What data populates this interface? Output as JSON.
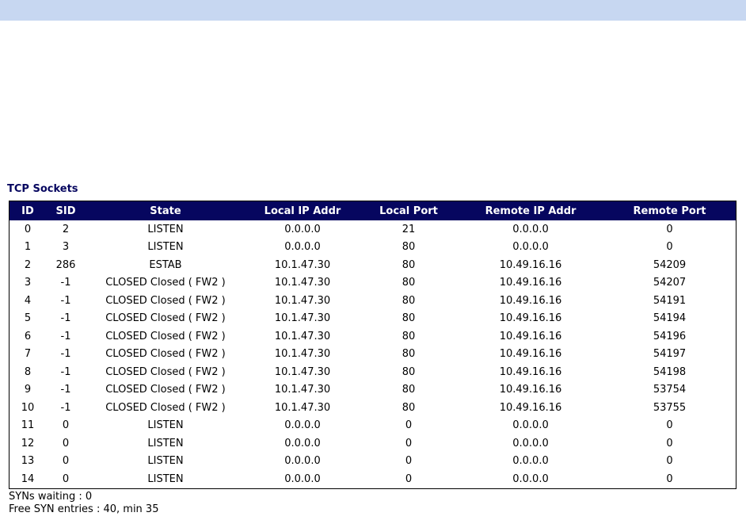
{
  "section_title": "TCP Sockets",
  "columns": [
    "ID",
    "SID",
    "State",
    "Local IP Addr",
    "Local Port",
    "Remote IP Addr",
    "Remote Port"
  ],
  "rows": [
    [
      "0",
      "2",
      "LISTEN",
      "0.0.0.0",
      "21",
      "0.0.0.0",
      "0"
    ],
    [
      "1",
      "3",
      "LISTEN",
      "0.0.0.0",
      "80",
      "0.0.0.0",
      "0"
    ],
    [
      "2",
      "286",
      "ESTAB",
      "10.1.47.30",
      "80",
      "10.49.16.16",
      "54209"
    ],
    [
      "3",
      "-1",
      "CLOSED Closed ( FW2 )",
      "10.1.47.30",
      "80",
      "10.49.16.16",
      "54207"
    ],
    [
      "4",
      "-1",
      "CLOSED Closed ( FW2 )",
      "10.1.47.30",
      "80",
      "10.49.16.16",
      "54191"
    ],
    [
      "5",
      "-1",
      "CLOSED Closed ( FW2 )",
      "10.1.47.30",
      "80",
      "10.49.16.16",
      "54194"
    ],
    [
      "6",
      "-1",
      "CLOSED Closed ( FW2 )",
      "10.1.47.30",
      "80",
      "10.49.16.16",
      "54196"
    ],
    [
      "7",
      "-1",
      "CLOSED Closed ( FW2 )",
      "10.1.47.30",
      "80",
      "10.49.16.16",
      "54197"
    ],
    [
      "8",
      "-1",
      "CLOSED Closed ( FW2 )",
      "10.1.47.30",
      "80",
      "10.49.16.16",
      "54198"
    ],
    [
      "9",
      "-1",
      "CLOSED Closed ( FW2 )",
      "10.1.47.30",
      "80",
      "10.49.16.16",
      "53754"
    ],
    [
      "10",
      "-1",
      "CLOSED Closed ( FW2 )",
      "10.1.47.30",
      "80",
      "10.49.16.16",
      "53755"
    ],
    [
      "11",
      "0",
      "LISTEN",
      "0.0.0.0",
      "0",
      "0.0.0.0",
      "0"
    ],
    [
      "12",
      "0",
      "LISTEN",
      "0.0.0.0",
      "0",
      "0.0.0.0",
      "0"
    ],
    [
      "13",
      "0",
      "LISTEN",
      "0.0.0.0",
      "0",
      "0.0.0.0",
      "0"
    ],
    [
      "14",
      "0",
      "LISTEN",
      "0.0.0.0",
      "0",
      "0.0.0.0",
      "0"
    ]
  ],
  "footer": {
    "syns_waiting": "SYNs waiting : 0",
    "free_syn_entries": "Free SYN entries : 40, min 35"
  },
  "colors": {
    "top_bar": "#c7d7f1",
    "header_bg": "#06065f",
    "title_text": "#06065f"
  }
}
